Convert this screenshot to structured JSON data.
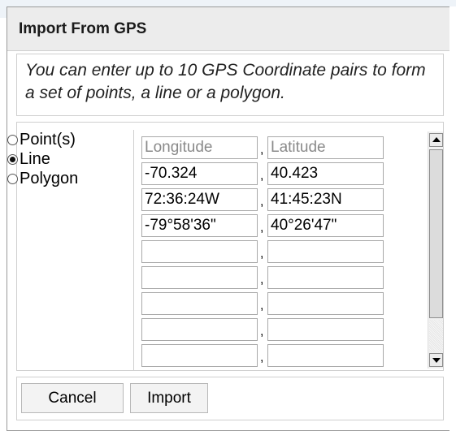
{
  "background": {
    "partial_text": "..."
  },
  "dialog": {
    "title": "Import From GPS",
    "instructions": "You can enter up to 10 GPS Coordinate pairs to form a set of points, a line or a polygon.",
    "geometry_options": [
      {
        "label": "Point(s)",
        "checked": false
      },
      {
        "label": "Line",
        "checked": true
      },
      {
        "label": "Polygon",
        "checked": false
      }
    ],
    "coordinates": {
      "longitude_placeholder": "Longitude",
      "latitude_placeholder": "Latitude",
      "separator": ",",
      "rows": [
        {
          "longitude": "",
          "latitude": ""
        },
        {
          "longitude": "-70.324",
          "latitude": "40.423"
        },
        {
          "longitude": "72:36:24W",
          "latitude": "41:45:23N"
        },
        {
          "longitude": "-79°58'36\"",
          "latitude": "40°26'47\""
        },
        {
          "longitude": "",
          "latitude": ""
        },
        {
          "longitude": "",
          "latitude": ""
        },
        {
          "longitude": "",
          "latitude": ""
        },
        {
          "longitude": "",
          "latitude": ""
        },
        {
          "longitude": "",
          "latitude": ""
        }
      ]
    },
    "buttons": {
      "cancel": "Cancel",
      "import": "Import"
    }
  },
  "colors": {
    "title_bar": "#ececec",
    "border": "#cfcfcf",
    "placeholder_text": "#8a8a8a"
  },
  "icons": [
    "radio-button",
    "scroll-up-arrow-icon",
    "scroll-down-arrow-icon"
  ]
}
